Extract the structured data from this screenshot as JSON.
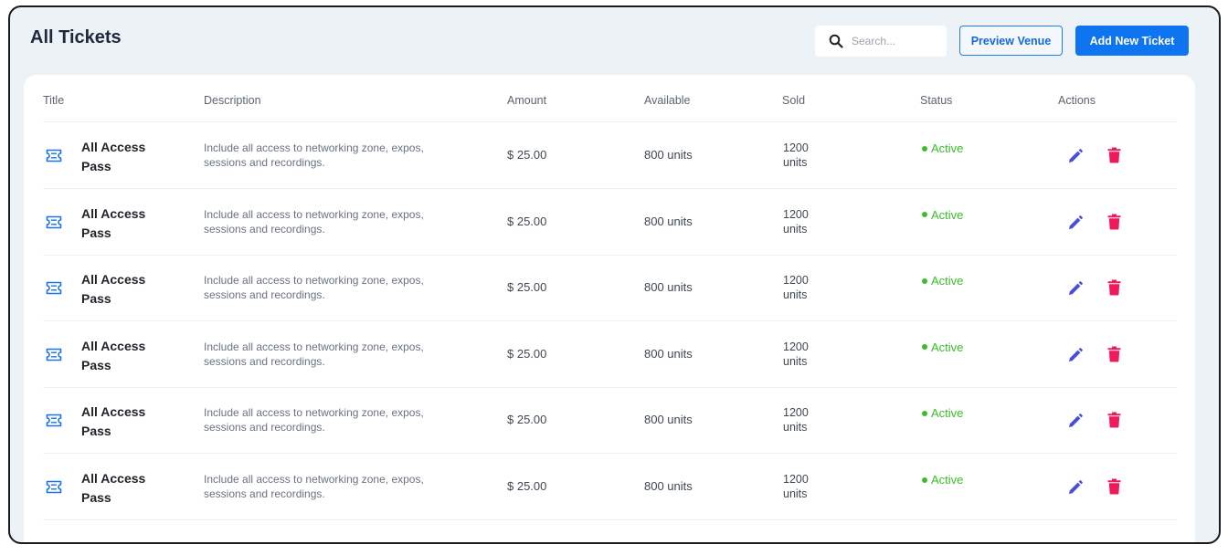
{
  "header": {
    "title": "All Tickets",
    "search_placeholder": "Search...",
    "preview_label": "Preview Venue",
    "add_label": "Add New Ticket"
  },
  "table": {
    "columns": [
      "Title",
      "Description",
      "Amount",
      "Available",
      "Sold",
      "Status",
      "Actions"
    ],
    "rows": [
      {
        "title": "All Access Pass",
        "description": "Include all access to networking zone, expos, sessions and recordings.",
        "amount": "$ 25.00",
        "available": "800 units",
        "sold": "1200 units",
        "status": "Active"
      },
      {
        "title": "All Access Pass",
        "description": "Include all access to networking zone, expos, sessions and recordings.",
        "amount": "$ 25.00",
        "available": "800 units",
        "sold": "1200 units",
        "status": "Active"
      },
      {
        "title": "All Access Pass",
        "description": "Include all access to networking zone, expos, sessions and recordings.",
        "amount": "$ 25.00",
        "available": "800 units",
        "sold": "1200 units",
        "status": "Active"
      },
      {
        "title": "All Access Pass",
        "description": "Include all access to networking zone, expos, sessions and recordings.",
        "amount": "$ 25.00",
        "available": "800 units",
        "sold": "1200 units",
        "status": "Active"
      },
      {
        "title": "All Access Pass",
        "description": "Include all access to networking zone, expos, sessions and recordings.",
        "amount": "$ 25.00",
        "available": "800 units",
        "sold": "1200 units",
        "status": "Active"
      },
      {
        "title": "All Access Pass",
        "description": "Include all access to networking zone, expos, sessions and recordings.",
        "amount": "$ 25.00",
        "available": "800 units",
        "sold": "1200 units",
        "status": "Active"
      }
    ]
  },
  "icons": {
    "search": "search-icon",
    "ticket": "ticket-icon",
    "edit": "pencil-icon",
    "delete": "trash-icon"
  },
  "colors": {
    "primary": "#0e74f0",
    "active": "#3bbd2a",
    "edit": "#4b4fd0",
    "delete": "#ef1a5a",
    "page_bg": "#edf2f7"
  }
}
